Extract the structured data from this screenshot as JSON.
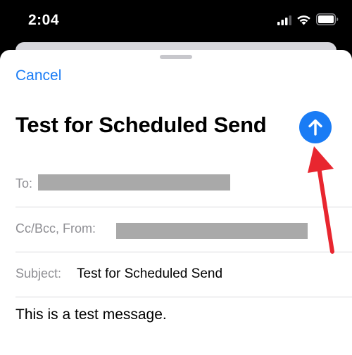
{
  "status_bar": {
    "time": "2:04",
    "icons": [
      "signal-icon",
      "wifi-icon",
      "battery-icon"
    ]
  },
  "compose": {
    "cancel_label": "Cancel",
    "title": "Test for Scheduled Send",
    "send_icon": "arrow-up-icon",
    "fields": {
      "to_label": "To:",
      "cc_from_label": "Cc/Bcc, From:",
      "subject_label": "Subject:",
      "subject_value": "Test for Scheduled Send"
    },
    "body": "This is a test message."
  },
  "annotation": {
    "arrow_color": "#e8262f",
    "points_to": "send-button"
  },
  "colors": {
    "accent": "#1a7cf5",
    "label_gray": "#8e8e93",
    "redaction": "#a9a9a9"
  }
}
